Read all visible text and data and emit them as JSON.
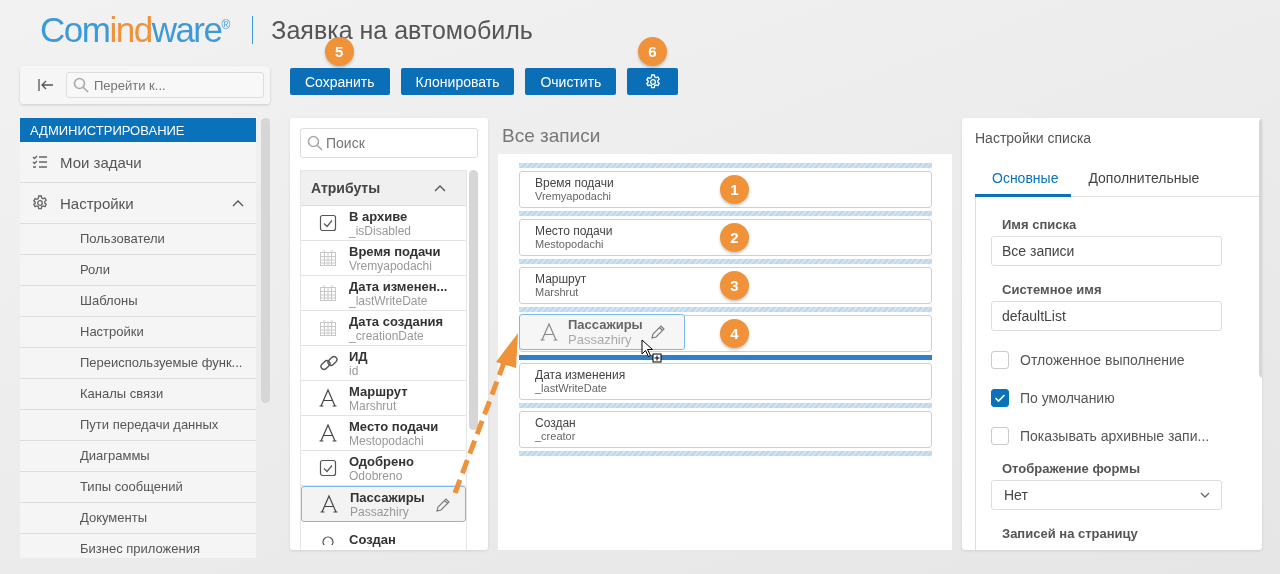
{
  "header": {
    "logo": [
      {
        "text": "Com",
        "color": "#3d9ad8"
      },
      {
        "text": "ind",
        "color": "#f0923a"
      },
      {
        "text": "ware$^{®}$",
        "color": "#3d9ad8"
      }
    ],
    "title": "Заявка на автомобиль"
  },
  "nav_search": {
    "placeholder": "Перейти к..."
  },
  "toolbar": [
    {
      "kind": "text",
      "label": "Сохранить",
      "badge": "5"
    },
    {
      "kind": "text",
      "label": "Клонировать"
    },
    {
      "kind": "text",
      "label": "Очистить"
    },
    {
      "kind": "settings",
      "badge": "6"
    }
  ],
  "sidebar": {
    "header": "АДМИНИСТРИРОВАНИЕ",
    "items": [
      {
        "kind": "tasks",
        "label": "Мои задачи"
      },
      {
        "kind": "settings",
        "label": "Настройки",
        "expanded": true,
        "children": [
          {
            "label": "Пользователи"
          },
          {
            "label": "Роли"
          },
          {
            "label": "Шаблоны"
          },
          {
            "label": "Настройки"
          },
          {
            "label": "Переиспользуемые функ..."
          },
          {
            "label": "Каналы связи"
          },
          {
            "label": "Пути передачи данных"
          },
          {
            "label": "Диаграммы"
          },
          {
            "label": "Типы сообщений"
          },
          {
            "label": "Документы"
          },
          {
            "label": "Бизнес приложения"
          }
        ]
      }
    ]
  },
  "attributes": {
    "search_placeholder": "Поиск",
    "header": "Атрибуты",
    "expanded": true,
    "items": [
      {
        "kind": "boolean",
        "name": "В архиве",
        "system_name": "_isDisabled",
        "selected": false
      },
      {
        "kind": "date",
        "name": "Время подачи",
        "system_name": "Vremyapodachi",
        "selected": false
      },
      {
        "kind": "date",
        "name": "Дата изменен...",
        "system_name": "_lastWriteDate",
        "selected": false
      },
      {
        "kind": "date",
        "name": "Дата создания",
        "system_name": "_creationDate",
        "selected": false
      },
      {
        "kind": "link",
        "name": "ИД",
        "system_name": "id",
        "selected": false
      },
      {
        "kind": "text",
        "name": "Маршрут",
        "system_name": "Marshrut",
        "selected": false
      },
      {
        "kind": "text",
        "name": "Место подачи",
        "system_name": "Mestopodachi",
        "selected": false
      },
      {
        "kind": "boolean",
        "name": "Одобрено",
        "system_name": "Odobreno",
        "selected": false
      },
      {
        "kind": "text",
        "name": "Пассажиры",
        "system_name": "Passazhiry",
        "selected": true
      },
      {
        "kind": "user",
        "name": "Создан",
        "selected": false
      }
    ]
  },
  "list": {
    "title": "Все записи",
    "rows": [
      {
        "kind": "field",
        "label": "Время подачи",
        "system_name": "Vremyapodachi",
        "badge": "1",
        "drop_before": false
      },
      {
        "kind": "field",
        "label": "Место подачи",
        "system_name": "Mestopodachi",
        "badge": "2",
        "drop_before": false
      },
      {
        "kind": "field",
        "label": "Маршрут",
        "system_name": "Marshrut",
        "badge": "3",
        "drop_before": false
      },
      {
        "kind": "dragging",
        "badge": "4",
        "drop_before": false,
        "ghost": {
          "label": "Пассажиры",
          "system_name": "Passazhiry"
        }
      },
      {
        "kind": "field",
        "label": "Дата изменения",
        "system_name": "_lastWriteDate",
        "drop_before": true
      },
      {
        "kind": "field",
        "label": "Создан",
        "system_name": "_creator",
        "drop_before": false
      }
    ]
  },
  "settings": {
    "title": "Настройки списка",
    "tabs": [
      {
        "label": "Основные",
        "selected": true
      },
      {
        "label": "Дополнительные",
        "selected": false
      }
    ],
    "fields": [
      {
        "kind": "input",
        "label": "Имя списка",
        "value": "Все записи"
      },
      {
        "kind": "input",
        "label": "Системное имя",
        "value": "defaultList"
      },
      {
        "kind": "checkbox",
        "label": "Отложенное выполнение",
        "checked": false
      },
      {
        "kind": "checkbox",
        "label": "По умолчанию",
        "checked": true
      },
      {
        "kind": "checkbox",
        "label": "Показывать архивные запи...",
        "checked": false
      },
      {
        "kind": "select",
        "label": "Отображение формы",
        "value": "Нет"
      },
      {
        "kind": "heading",
        "label": "Записей на страницу"
      }
    ]
  }
}
